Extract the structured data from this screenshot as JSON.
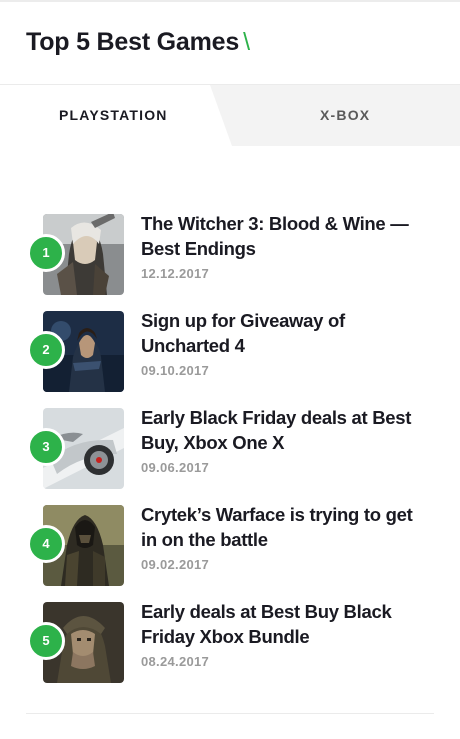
{
  "widget": {
    "title": "Top 5 Best Games",
    "title_accent": "\\"
  },
  "tabs": [
    {
      "label": "PLAYSTATION",
      "active": true
    },
    {
      "label": "X-BOX",
      "active": false
    }
  ],
  "items": [
    {
      "rank": "1",
      "title": "The Witcher 3: Blood & Wine — Best Endings",
      "date": "12.12.2017",
      "thumb": "witcher-thumbnail"
    },
    {
      "rank": "2",
      "title": "Sign up for Giveaway of Uncharted 4",
      "date": "09.10.2017",
      "thumb": "uncharted-thumbnail"
    },
    {
      "rank": "3",
      "title": "Early Black Friday deals at Best Buy, Xbox One X",
      "date": "09.06.2017",
      "thumb": "xbox-thumbnail"
    },
    {
      "rank": "4",
      "title": "Crytek’s Warface is trying to get in on the battle",
      "date": "09.02.2017",
      "thumb": "warface-thumbnail"
    },
    {
      "rank": "5",
      "title": "Early deals at Best Buy Black Friday Xbox Bundle",
      "date": "08.24.2017",
      "thumb": "soldier-thumbnail"
    }
  ],
  "colors": {
    "accent": "#2db24a",
    "title": "#1a1a22",
    "date": "#9a9a9a",
    "tab_inactive_bg": "#f3f3f3"
  }
}
